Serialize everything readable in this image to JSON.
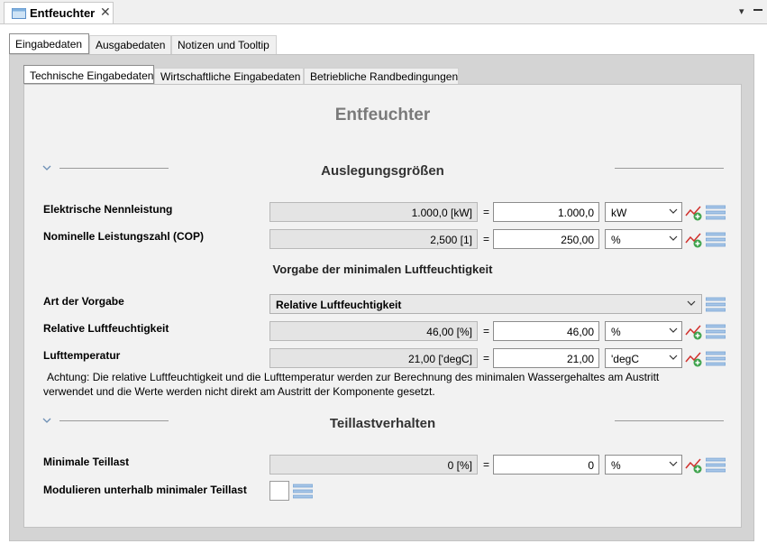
{
  "editor_tab": {
    "title": "Entfeuchter",
    "close": "✕"
  },
  "outer_tabs": [
    "Eingabedaten",
    "Ausgabedaten",
    "Notizen und Tooltip"
  ],
  "inner_tabs": [
    "Technische Eingabedaten",
    "Wirtschaftliche Eingabedaten",
    "Betriebliche Randbedingungen"
  ],
  "heading": "Entfeuchter",
  "sections": {
    "auslegung": "Auslegungsgrößen",
    "vorgabe": "Vorgabe der minimalen Luftfeuchtigkeit",
    "teillast": "Teillastverhalten"
  },
  "rows": {
    "nennleistung": {
      "label": "Elektrische Nennleistung",
      "readonly": "1.000,0 [kW]",
      "eq": "=",
      "value": "1.000,0",
      "unit": "kW"
    },
    "cop": {
      "label": "Nominelle Leistungszahl (COP)",
      "readonly": "2,500 [1]",
      "eq": "=",
      "value": "250,00",
      "unit": "%"
    },
    "art": {
      "label": "Art der Vorgabe",
      "value": "Relative Luftfeuchtigkeit"
    },
    "rel_feuchte": {
      "label": "Relative Luftfeuchtigkeit",
      "readonly": "46,00 [%]",
      "eq": "=",
      "value": "46,00",
      "unit": "%"
    },
    "lufttemp": {
      "label": "Lufttemperatur",
      "readonly": "21,00 ['degC]",
      "eq": "=",
      "value": "21,00",
      "unit": "'degC"
    },
    "min_teillast": {
      "label": "Minimale Teillast",
      "readonly": "0 [%]",
      "eq": "=",
      "value": "0",
      "unit": "%"
    },
    "modulieren": {
      "label": "Modulieren unterhalb minimaler Teillast"
    }
  },
  "note_line1": "Achtung: Die relative Luftfeuchtigkeit und die Lufttemperatur werden zur Berechnung des minimalen Wassergehaltes am Austritt",
  "note_line2": "verwendet und die Werte werden nicht direkt am Austritt der Komponente gesetzt.",
  "view_menu": "▾"
}
